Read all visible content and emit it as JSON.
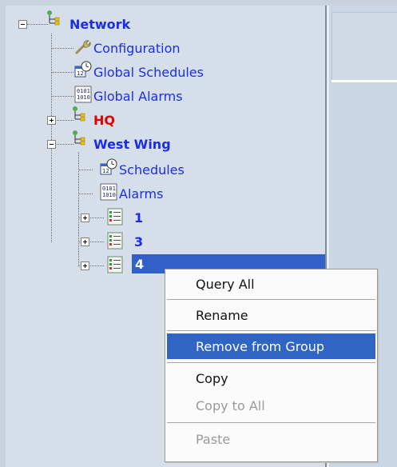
{
  "tree": {
    "network": "Network",
    "configuration": "Configuration",
    "global_schedules": "Global Schedules",
    "global_alarms": "Global Alarms",
    "hq": "HQ",
    "west_wing": "West Wing",
    "schedules": "Schedules",
    "alarms": "Alarms",
    "device_1": "1",
    "device_3": "3",
    "device_4": "4"
  },
  "context_menu": {
    "query_all": "Query All",
    "rename": "Rename",
    "remove_from_group": "Remove from Group",
    "copy": "Copy",
    "copy_to_all": "Copy to All",
    "paste": "Paste"
  },
  "colors": {
    "tree_text": "#1a2eea",
    "hq_text": "#e00000",
    "selection": "#3060c8",
    "menu_highlight": "#3165c5",
    "disabled_text": "#9a9a9a"
  },
  "icons": {
    "network": "network-tree-icon",
    "configuration": "wrench-icon",
    "schedules": "calendar-clock-icon",
    "alarms": "binary-alarm-icon",
    "device": "device-list-icon"
  }
}
